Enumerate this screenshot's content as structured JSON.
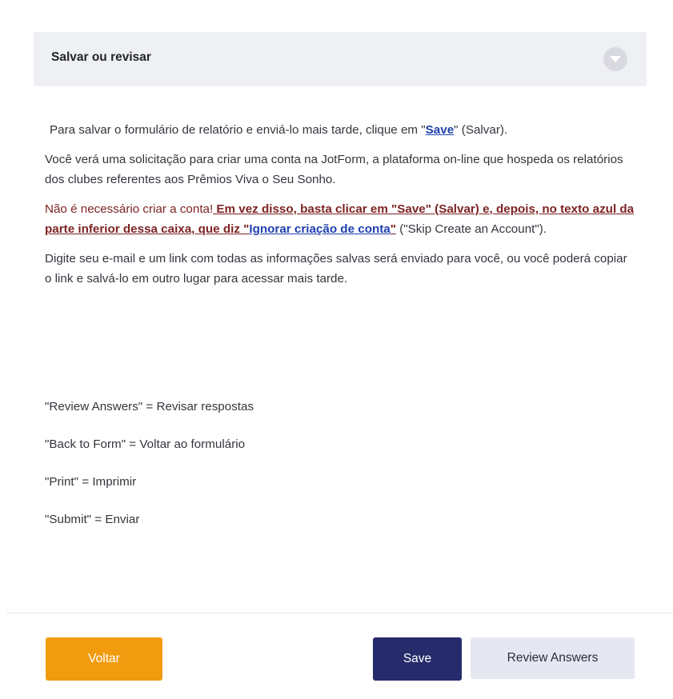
{
  "section": {
    "title": "Salvar ou revisar"
  },
  "content": {
    "p1": {
      "before": "Para salvar o formulário de relatório e enviá-lo mais tarde, clique em \"",
      "link": "Save",
      "after": "\" (Salvar)."
    },
    "p2": "Você verá uma solicitação para criar uma conta na JotForm, a plataforma on-line que hospeda os relatórios dos clubes referentes aos Prêmios Viva o Seu Sonho.",
    "p3": {
      "intro": "Não é necessário criar a conta!",
      "bold": " Em vez disso, basta clicar em \"Save\" (Salvar) e, depois, no texto azul da parte inferior dessa caixa, que diz \"",
      "link": "Ignorar criação de conta",
      "link_close": "\"",
      "after": " (\"Skip Create an Account\")."
    },
    "p4": "Digite seu e-mail e um link com todas as informações salvas será enviado para você, ou você poderá copiar o link e salvá-lo em outro lugar para acessar mais tarde."
  },
  "glossary": [
    "\"Review Answers\" = Revisar respostas",
    "\"Back to Form\" = Voltar ao formulário",
    "\"Print\" = Imprimir",
    "\"Submit\" = Enviar"
  ],
  "footer": {
    "back_label": "Voltar",
    "save_label": "Save",
    "review_label": "Review Answers"
  },
  "icons": {
    "collapse": "chevron-down-icon"
  },
  "colors": {
    "back_button": "#f19b0f",
    "save_button": "#262c6b",
    "review_button": "#e6e8f1",
    "header_bg": "#eff0f4",
    "link_blue": "#1f3fae",
    "warning_red": "#7d2323"
  }
}
